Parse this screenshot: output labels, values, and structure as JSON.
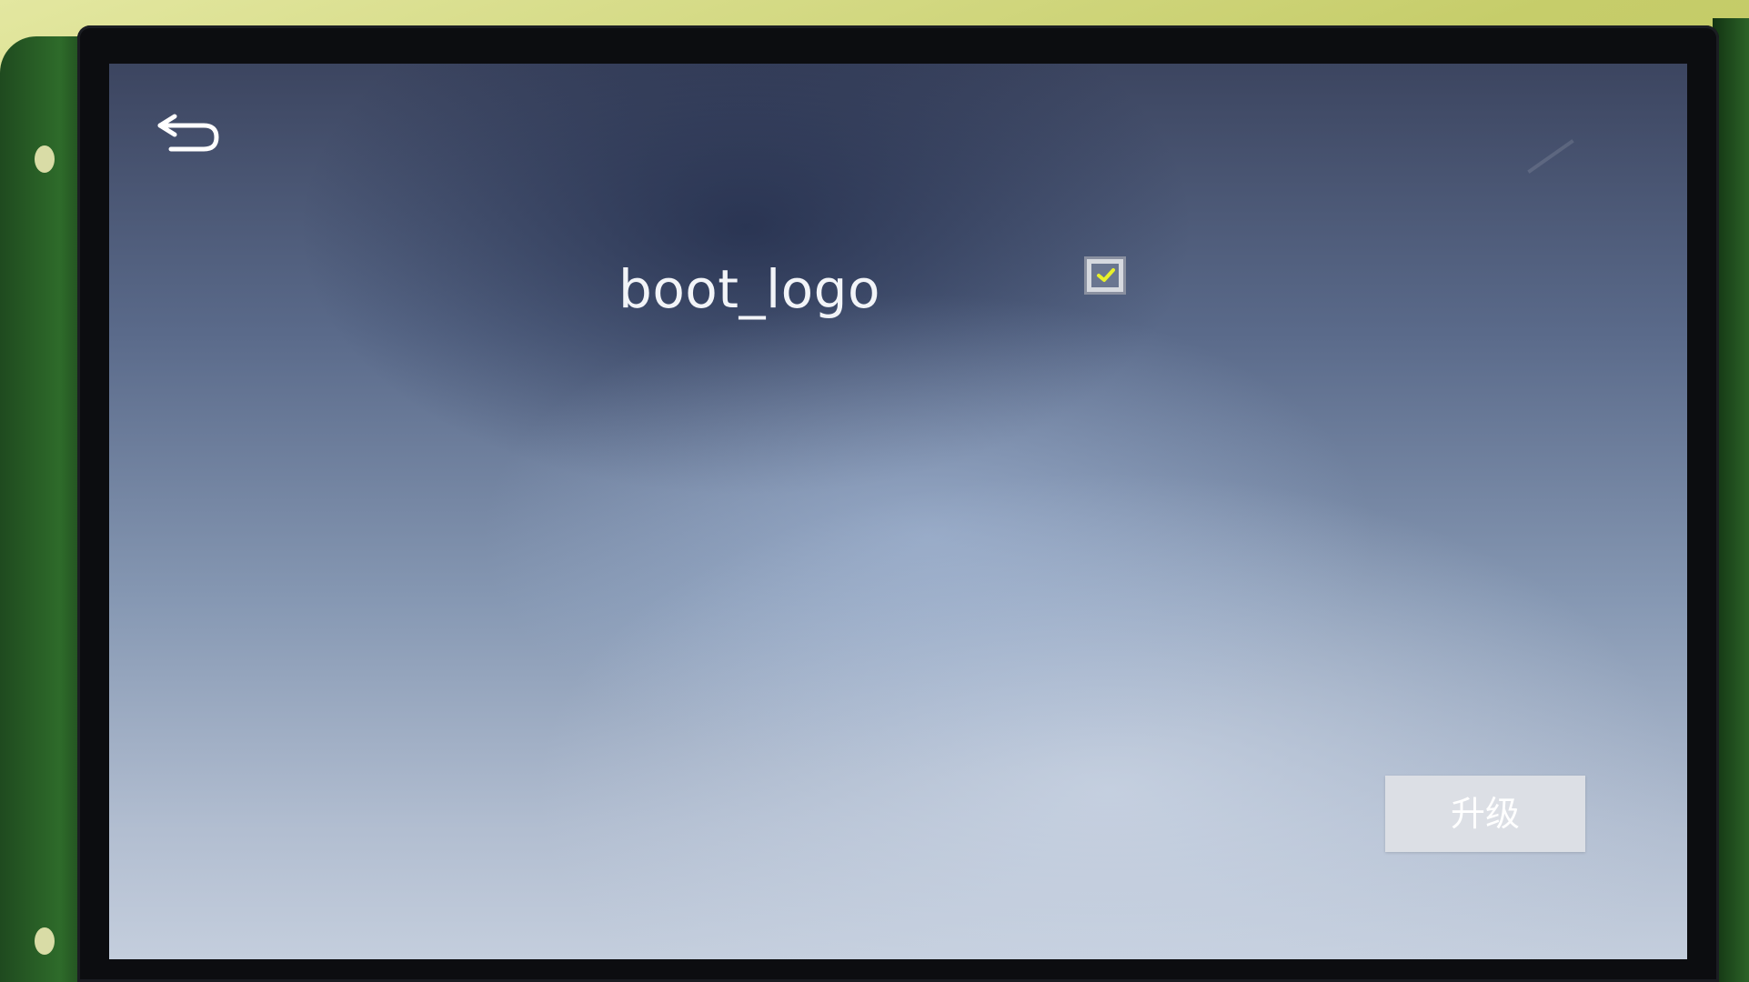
{
  "screen": {
    "back_icon": "back-arrow-icon",
    "item": {
      "label": "boot_logo",
      "checked": true,
      "check_icon": "check-icon",
      "check_color": "#e8f02a"
    },
    "upgrade_button_label": "升级"
  }
}
